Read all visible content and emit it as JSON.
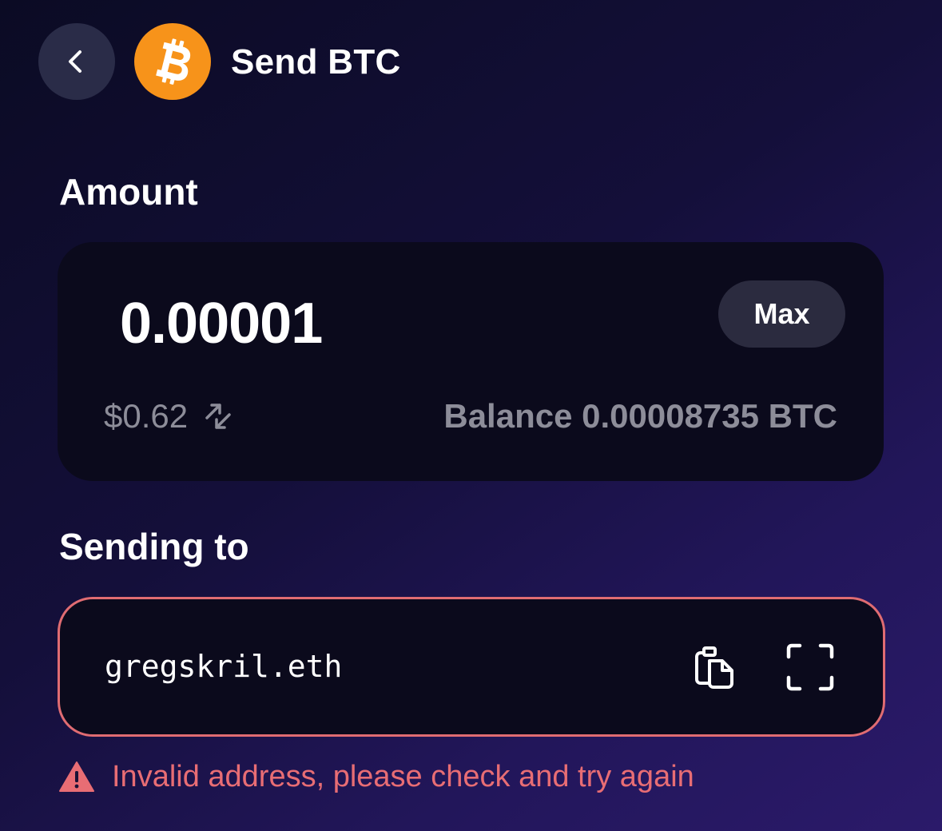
{
  "header": {
    "title": "Send BTC",
    "back_icon": "chevron-left-icon",
    "coin_icon": "bitcoin-icon",
    "coin_color": "#f7931a"
  },
  "amount_section": {
    "label": "Amount",
    "value": "0.00001",
    "max_label": "Max",
    "fiat_value": "$0.62",
    "swap_icon": "swap-arrows-icon",
    "balance": "Balance 0.00008735 BTC"
  },
  "recipient_section": {
    "label": "Sending to",
    "address_value": "gregskril.eth",
    "paste_icon": "clipboard-icon",
    "scan_icon": "scan-qr-icon",
    "error_color": "#e86d74",
    "error_icon": "warning-icon",
    "error_message": "Invalid address, please check and try again"
  }
}
